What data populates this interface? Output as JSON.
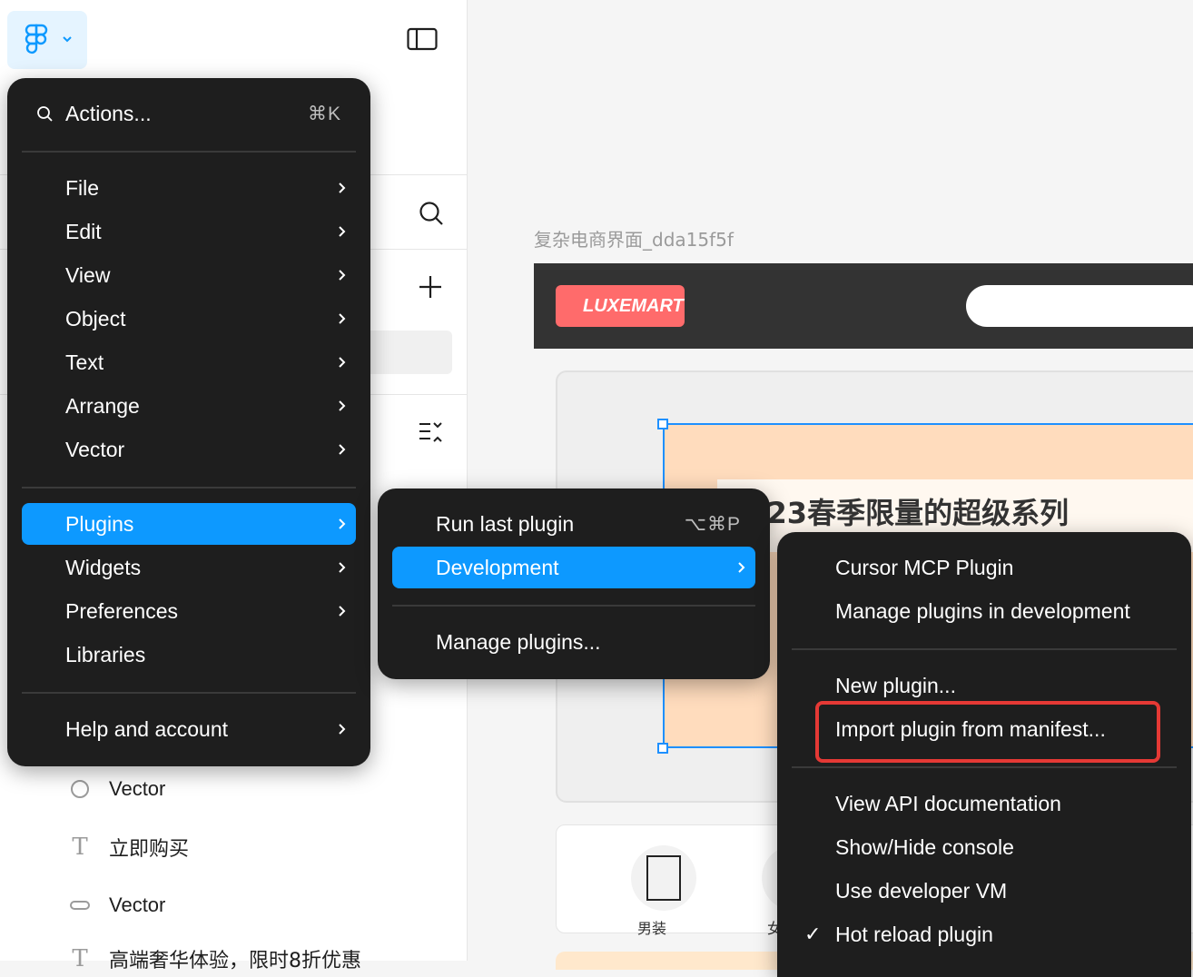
{
  "canvas": {
    "frame_label": "复杂电商界面_dda15f5f",
    "brand": "LUXEMART",
    "hero_title": "2023春季限量的超级系列",
    "categories": [
      "男装",
      "女"
    ]
  },
  "layers": [
    {
      "icon": "ellipse-icon",
      "label": "Vector"
    },
    {
      "icon": "text-icon",
      "label": "立即购买"
    },
    {
      "icon": "rectangle-icon",
      "label": "Vector"
    },
    {
      "icon": "text-icon",
      "label": "高端奢华体验，限时8折优惠"
    }
  ],
  "main_menu": {
    "search_label": "Actions...",
    "search_shortcut": "⌘K",
    "items": [
      "File",
      "Edit",
      "View",
      "Object",
      "Text",
      "Arrange",
      "Vector"
    ],
    "plugins": "Plugins",
    "widgets": "Widgets",
    "preferences": "Preferences",
    "libraries": "Libraries",
    "help": "Help and account"
  },
  "plugins_menu": {
    "run_last": "Run last plugin",
    "run_last_shortcut": "⌥⌘P",
    "development": "Development",
    "manage": "Manage plugins..."
  },
  "dev_menu": {
    "cursor_mcp": "Cursor MCP Plugin",
    "manage_dev": "Manage plugins in development",
    "new_plugin": "New plugin...",
    "import_manifest": "Import plugin from manifest...",
    "api_docs": "View API documentation",
    "console": "Show/Hide console",
    "dev_vm": "Use developer VM",
    "hot_reload": "Hot reload plugin",
    "hot_reload_checked": "✓"
  },
  "colors": {
    "menu_bg": "#1e1e1e",
    "accent": "#0d99ff",
    "highlight_outline": "#e53935",
    "brand_red": "#ff6b6b"
  }
}
